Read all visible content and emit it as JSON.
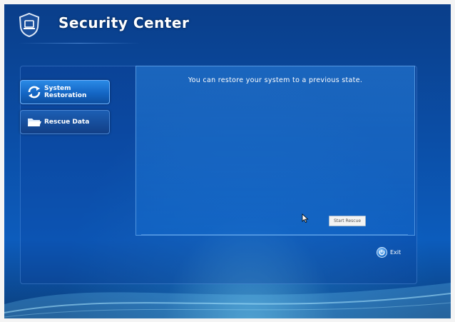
{
  "app": {
    "title": "Security Center"
  },
  "sidebar": {
    "items": [
      {
        "label": "System Restoration",
        "icon": "refresh-icon"
      },
      {
        "label": "Rescue Data",
        "icon": "folder-icon"
      }
    ]
  },
  "main": {
    "message": "You can restore your system to a previous state.",
    "start_button": "Start Rescue"
  },
  "footer": {
    "exit_label": "Exit",
    "exit_icon": "power-icon"
  },
  "colors": {
    "accent": "#1466c4",
    "background": "#0b4fa8"
  }
}
